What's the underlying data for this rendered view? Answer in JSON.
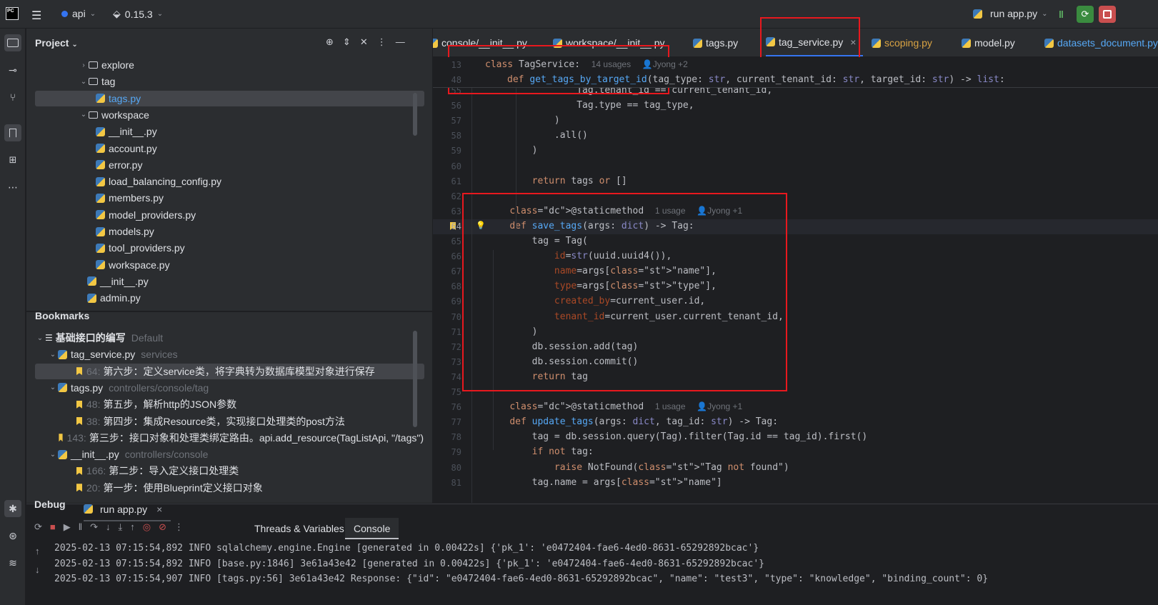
{
  "titlebar": {
    "project": "api",
    "branch": "0.15.3",
    "run_config": "run app.py"
  },
  "project_panel": {
    "title": "Project",
    "tree": [
      {
        "indent": 1,
        "type": "folder",
        "label": "explore",
        "expanded": false
      },
      {
        "indent": 1,
        "type": "folder",
        "label": "tag",
        "expanded": true
      },
      {
        "indent": 2,
        "type": "py",
        "label": "tags.py",
        "selected": true
      },
      {
        "indent": 1,
        "type": "folder",
        "label": "workspace",
        "expanded": true
      },
      {
        "indent": 2,
        "type": "py",
        "label": "__init__.py"
      },
      {
        "indent": 2,
        "type": "py",
        "label": "account.py"
      },
      {
        "indent": 2,
        "type": "py",
        "label": "error.py"
      },
      {
        "indent": 2,
        "type": "py",
        "label": "load_balancing_config.py"
      },
      {
        "indent": 2,
        "type": "py",
        "label": "members.py"
      },
      {
        "indent": 2,
        "type": "py",
        "label": "model_providers.py"
      },
      {
        "indent": 2,
        "type": "py",
        "label": "models.py"
      },
      {
        "indent": 2,
        "type": "py",
        "label": "tool_providers.py"
      },
      {
        "indent": 2,
        "type": "py",
        "label": "workspace.py"
      },
      {
        "indent": 1,
        "type": "py",
        "label": "__init__.py"
      },
      {
        "indent": 1,
        "type": "py",
        "label": "admin.py"
      }
    ]
  },
  "bookmarks_panel": {
    "title": "Bookmarks",
    "rows": [
      {
        "level": 0,
        "kind": "group",
        "label": "基础接口的编写",
        "meta": "Default"
      },
      {
        "level": 1,
        "kind": "file",
        "label": "tag_service.py",
        "meta": "services"
      },
      {
        "level": 2,
        "kind": "mark",
        "line": "64:",
        "label": "第六步：定义service类，将字典转为数据库模型对象进行保存",
        "selected": true
      },
      {
        "level": 1,
        "kind": "file",
        "label": "tags.py",
        "meta": "controllers/console/tag"
      },
      {
        "level": 2,
        "kind": "mark",
        "line": "48:",
        "label": "第五步，解析http的JSON参数"
      },
      {
        "level": 2,
        "kind": "mark",
        "line": "38:",
        "label": "第四步：集成Resource类，实现接口处理类的post方法"
      },
      {
        "level": 2,
        "kind": "mark",
        "line": "143:",
        "label": "第三步：接口对象和处理类绑定路由。api.add_resource(TagListApi, \"/tags\")"
      },
      {
        "level": 1,
        "kind": "file",
        "label": "__init__.py",
        "meta": "controllers/console"
      },
      {
        "level": 2,
        "kind": "mark",
        "line": "166:",
        "label": "第二步：导入定义接口处理类"
      },
      {
        "level": 2,
        "kind": "mark",
        "line": "20:",
        "label": "第一步：使用Blueprint定义接口对象"
      }
    ]
  },
  "editor_tabs": [
    {
      "label": "console/__init__.py"
    },
    {
      "label": "workspace/__init__.py"
    },
    {
      "label": "tags.py"
    },
    {
      "label": "tag_service.py",
      "active": true
    },
    {
      "label": "scoping.py",
      "modified": true
    },
    {
      "label": "model.py"
    },
    {
      "label": "datasets_document.py"
    }
  ],
  "sticky": {
    "l1": {
      "num": "13",
      "text": "class TagService:",
      "hint": "14 usages",
      "author": "Jyong +2"
    },
    "l2": {
      "num": "48",
      "text": "def get_tags_by_target_id(tag_type: str, current_tenant_id: str, target_id: str) -> list:"
    }
  },
  "code_lines": [
    {
      "n": "55",
      "t": "                Tag.tenant_id == current_tenant_id,"
    },
    {
      "n": "56",
      "t": "                Tag.type == tag_type,"
    },
    {
      "n": "57",
      "t": "            )"
    },
    {
      "n": "58",
      "t": "            .all()"
    },
    {
      "n": "59",
      "t": "        )"
    },
    {
      "n": "60",
      "t": ""
    },
    {
      "n": "61",
      "t": "        return tags or []"
    },
    {
      "n": "62",
      "t": ""
    },
    {
      "n": "63",
      "t": "    @staticmethod",
      "hint": "1 usage",
      "author": "Jyong +1"
    },
    {
      "n": "64",
      "t": "    def save_tags(args: dict) -> Tag:"
    },
    {
      "n": "65",
      "t": "        tag = Tag("
    },
    {
      "n": "66",
      "t": "            id=str(uuid.uuid4()),"
    },
    {
      "n": "67",
      "t": "            name=args[\"name\"],"
    },
    {
      "n": "68",
      "t": "            type=args[\"type\"],"
    },
    {
      "n": "69",
      "t": "            created_by=current_user.id,"
    },
    {
      "n": "70",
      "t": "            tenant_id=current_user.current_tenant_id,"
    },
    {
      "n": "71",
      "t": "        )"
    },
    {
      "n": "72",
      "t": "        db.session.add(tag)"
    },
    {
      "n": "73",
      "t": "        db.session.commit()"
    },
    {
      "n": "74",
      "t": "        return tag"
    },
    {
      "n": "75",
      "t": ""
    },
    {
      "n": "76",
      "t": "    @staticmethod",
      "hint": "1 usage",
      "author": "Jyong +1"
    },
    {
      "n": "77",
      "t": "    def update_tags(args: dict, tag_id: str) -> Tag:"
    },
    {
      "n": "78",
      "t": "        tag = db.session.query(Tag).filter(Tag.id == tag_id).first()"
    },
    {
      "n": "79",
      "t": "        if not tag:"
    },
    {
      "n": "80",
      "t": "            raise NotFound(\"Tag not found\")"
    },
    {
      "n": "81",
      "t": "        tag.name = args[\"name\"]"
    }
  ],
  "debug": {
    "title": "Debug",
    "session_tab": "run app.py",
    "tabs": [
      "Threads & Variables",
      "Console"
    ],
    "active_tab": "Console",
    "logs": [
      "2025-02-13 07:15:54,892 INFO sqlalchemy.engine.Engine [generated in 0.00422s] {'pk_1': 'e0472404-fae6-4ed0-8631-65292892bcac'}",
      "2025-02-13 07:15:54,892 INFO [base.py:1846] 3e61a43e42 [generated in 0.00422s] {'pk_1': 'e0472404-fae6-4ed0-8631-65292892bcac'}",
      "2025-02-13 07:15:54,907 INFO [tags.py:56] 3e61a43e42 Response: {\"id\": \"e0472404-fae6-4ed0-8631-65292892bcac\", \"name\": \"test3\", \"type\": \"knowledge\", \"binding_count\": 0}"
    ]
  },
  "colors": {
    "accent": "#3574f0",
    "annotation_red": "#e8181e",
    "bookmark": "#f2c744"
  }
}
